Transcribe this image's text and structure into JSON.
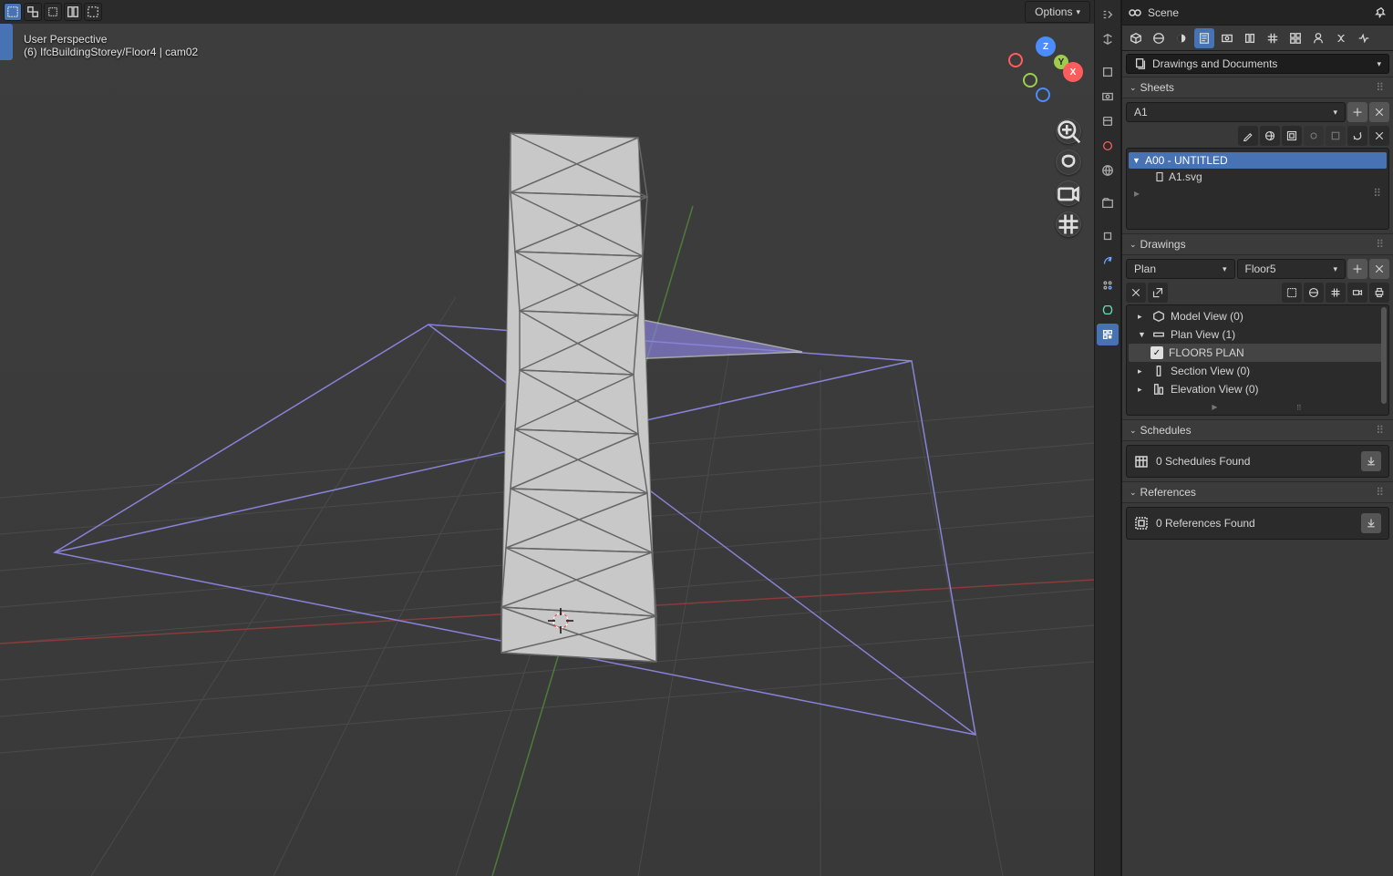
{
  "header": {
    "options_label": "Options"
  },
  "viewport": {
    "title": "User Perspective",
    "subtitle": "(6) IfcBuildingStorey/Floor4 | cam02",
    "axes": {
      "x": "X",
      "y": "Y",
      "z": "Z"
    }
  },
  "panel": {
    "scene_label": "Scene",
    "category_selector": "Drawings and Documents",
    "sheets": {
      "header": "Sheets",
      "selector": "A1",
      "tree_root": "A00 - UNTITLED",
      "tree_child": "A1.svg"
    },
    "drawings": {
      "header": "Drawings",
      "type_selector": "Plan",
      "target_selector": "Floor5",
      "items": [
        {
          "label": "Model View (0)",
          "expanded": false
        },
        {
          "label": "Plan View (1)",
          "expanded": true
        },
        {
          "label": "Section View (0)",
          "expanded": false
        },
        {
          "label": "Elevation View (0)",
          "expanded": false
        }
      ],
      "plan_child": "FLOOR5 PLAN"
    },
    "schedules": {
      "header": "Schedules",
      "message": "0 Schedules Found"
    },
    "references": {
      "header": "References",
      "message": "0 References Found"
    }
  }
}
